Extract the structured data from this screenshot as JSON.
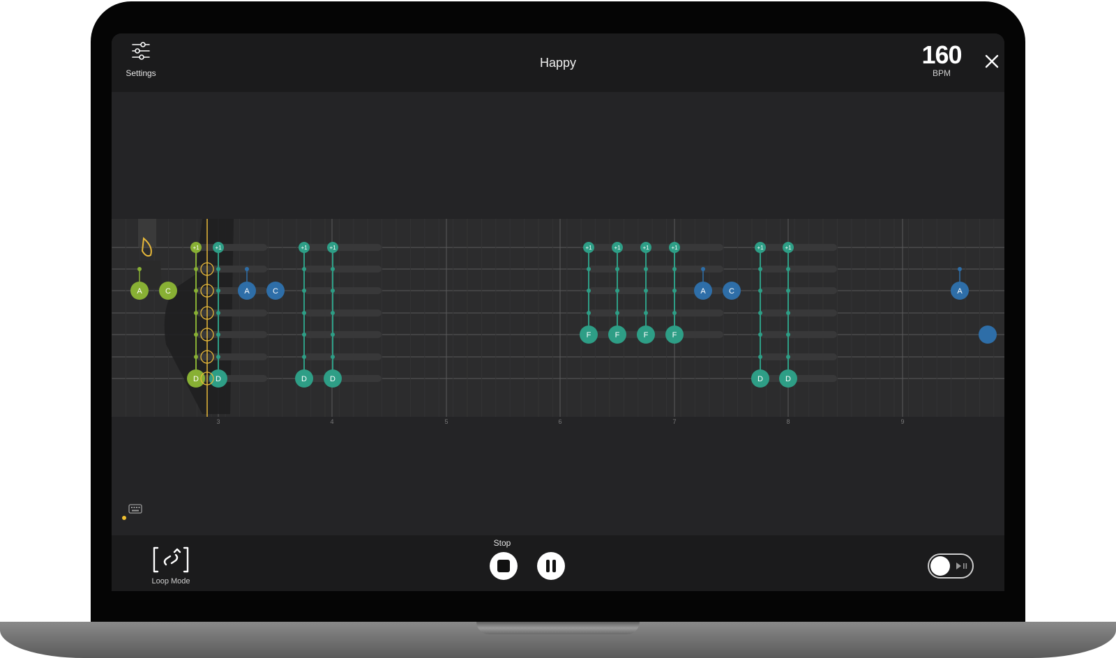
{
  "header": {
    "settings_label": "Settings",
    "song_title": "Happy",
    "bpm_value": "160",
    "bpm_label": "BPM"
  },
  "icons": {
    "settings": "sliders-icon",
    "close": "close-icon",
    "keyboard": "keyboard-icon",
    "loop": "loop-mode-icon",
    "stop": "stop-icon",
    "pause": "pause-icon",
    "toggle": "play-along-icon"
  },
  "colors": {
    "teal": "#2e9e86",
    "green": "#88b034",
    "blue": "#2e6ea8",
    "playhead": "#e8b93a"
  },
  "track": {
    "bar_numbers": [
      "3",
      "4",
      "5",
      "6",
      "7",
      "8",
      "9"
    ],
    "groups": [
      {
        "kind": "rest",
        "color": "green",
        "labels": [
          "A",
          "C"
        ]
      },
      {
        "kind": "chord",
        "color": "green",
        "top_label": "+1",
        "bottom_label": "D"
      },
      {
        "kind": "chord",
        "color": "teal",
        "top_label": "+1",
        "bottom_label": "D"
      },
      {
        "kind": "single",
        "color": "blue",
        "labels": [
          "A",
          "C"
        ]
      },
      {
        "kind": "chord",
        "color": "teal",
        "top_label": "+1",
        "bottom_label": "D"
      },
      {
        "kind": "chord",
        "color": "teal",
        "top_label": "+1",
        "bottom_label": "D"
      },
      {
        "kind": "chord_f",
        "color": "teal",
        "top_label": "+1",
        "bottom_label": "F"
      },
      {
        "kind": "chord_f",
        "color": "teal",
        "top_label": "+1",
        "bottom_label": "F"
      },
      {
        "kind": "chord_f",
        "color": "teal",
        "top_label": "+1",
        "bottom_label": "F"
      },
      {
        "kind": "chord_f",
        "color": "teal",
        "top_label": "+1",
        "bottom_label": "F"
      },
      {
        "kind": "single",
        "color": "blue",
        "labels": [
          "A",
          "C"
        ]
      },
      {
        "kind": "chord",
        "color": "teal",
        "top_label": "+1",
        "bottom_label": "D"
      },
      {
        "kind": "chord",
        "color": "teal",
        "top_label": "+1",
        "bottom_label": "D"
      },
      {
        "kind": "single",
        "color": "blue",
        "labels": [
          "A"
        ]
      }
    ]
  },
  "footer": {
    "loop_label": "Loop Mode",
    "stop_label": "Stop"
  }
}
